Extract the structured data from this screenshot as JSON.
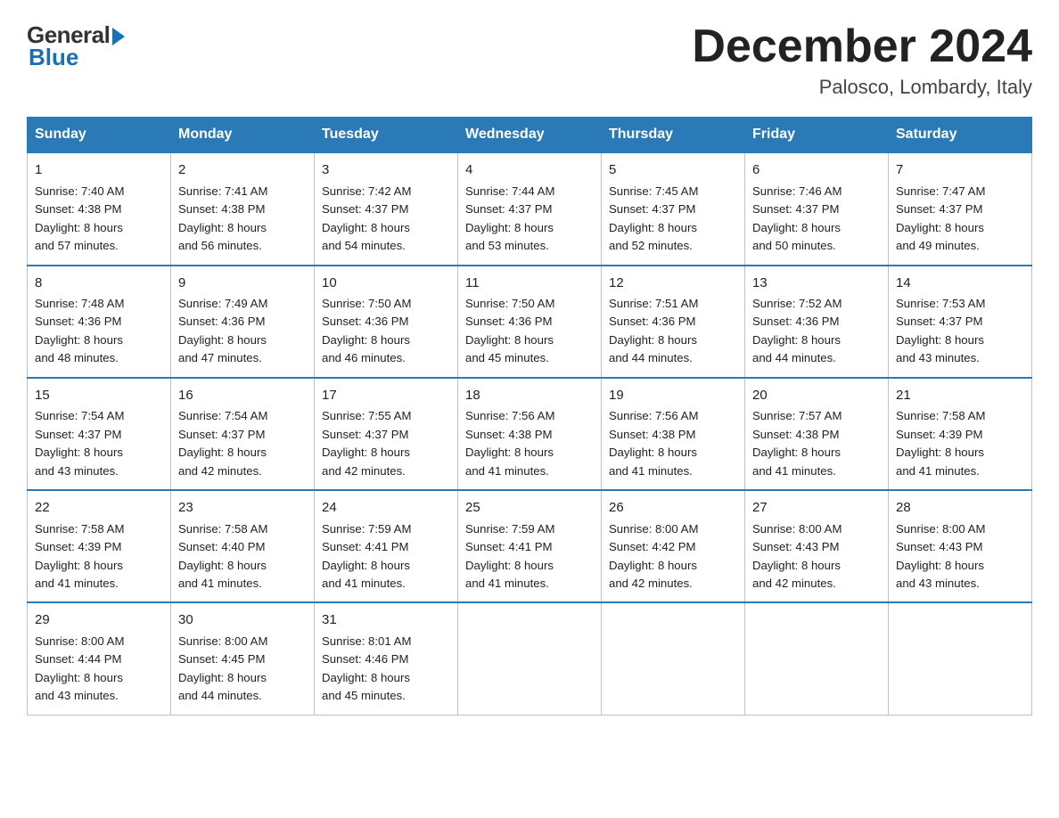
{
  "logo": {
    "general": "General",
    "blue": "Blue"
  },
  "header": {
    "month": "December 2024",
    "location": "Palosco, Lombardy, Italy"
  },
  "days_of_week": [
    "Sunday",
    "Monday",
    "Tuesday",
    "Wednesday",
    "Thursday",
    "Friday",
    "Saturday"
  ],
  "weeks": [
    [
      {
        "day": "1",
        "info": "Sunrise: 7:40 AM\nSunset: 4:38 PM\nDaylight: 8 hours\nand 57 minutes."
      },
      {
        "day": "2",
        "info": "Sunrise: 7:41 AM\nSunset: 4:38 PM\nDaylight: 8 hours\nand 56 minutes."
      },
      {
        "day": "3",
        "info": "Sunrise: 7:42 AM\nSunset: 4:37 PM\nDaylight: 8 hours\nand 54 minutes."
      },
      {
        "day": "4",
        "info": "Sunrise: 7:44 AM\nSunset: 4:37 PM\nDaylight: 8 hours\nand 53 minutes."
      },
      {
        "day": "5",
        "info": "Sunrise: 7:45 AM\nSunset: 4:37 PM\nDaylight: 8 hours\nand 52 minutes."
      },
      {
        "day": "6",
        "info": "Sunrise: 7:46 AM\nSunset: 4:37 PM\nDaylight: 8 hours\nand 50 minutes."
      },
      {
        "day": "7",
        "info": "Sunrise: 7:47 AM\nSunset: 4:37 PM\nDaylight: 8 hours\nand 49 minutes."
      }
    ],
    [
      {
        "day": "8",
        "info": "Sunrise: 7:48 AM\nSunset: 4:36 PM\nDaylight: 8 hours\nand 48 minutes."
      },
      {
        "day": "9",
        "info": "Sunrise: 7:49 AM\nSunset: 4:36 PM\nDaylight: 8 hours\nand 47 minutes."
      },
      {
        "day": "10",
        "info": "Sunrise: 7:50 AM\nSunset: 4:36 PM\nDaylight: 8 hours\nand 46 minutes."
      },
      {
        "day": "11",
        "info": "Sunrise: 7:50 AM\nSunset: 4:36 PM\nDaylight: 8 hours\nand 45 minutes."
      },
      {
        "day": "12",
        "info": "Sunrise: 7:51 AM\nSunset: 4:36 PM\nDaylight: 8 hours\nand 44 minutes."
      },
      {
        "day": "13",
        "info": "Sunrise: 7:52 AM\nSunset: 4:36 PM\nDaylight: 8 hours\nand 44 minutes."
      },
      {
        "day": "14",
        "info": "Sunrise: 7:53 AM\nSunset: 4:37 PM\nDaylight: 8 hours\nand 43 minutes."
      }
    ],
    [
      {
        "day": "15",
        "info": "Sunrise: 7:54 AM\nSunset: 4:37 PM\nDaylight: 8 hours\nand 43 minutes."
      },
      {
        "day": "16",
        "info": "Sunrise: 7:54 AM\nSunset: 4:37 PM\nDaylight: 8 hours\nand 42 minutes."
      },
      {
        "day": "17",
        "info": "Sunrise: 7:55 AM\nSunset: 4:37 PM\nDaylight: 8 hours\nand 42 minutes."
      },
      {
        "day": "18",
        "info": "Sunrise: 7:56 AM\nSunset: 4:38 PM\nDaylight: 8 hours\nand 41 minutes."
      },
      {
        "day": "19",
        "info": "Sunrise: 7:56 AM\nSunset: 4:38 PM\nDaylight: 8 hours\nand 41 minutes."
      },
      {
        "day": "20",
        "info": "Sunrise: 7:57 AM\nSunset: 4:38 PM\nDaylight: 8 hours\nand 41 minutes."
      },
      {
        "day": "21",
        "info": "Sunrise: 7:58 AM\nSunset: 4:39 PM\nDaylight: 8 hours\nand 41 minutes."
      }
    ],
    [
      {
        "day": "22",
        "info": "Sunrise: 7:58 AM\nSunset: 4:39 PM\nDaylight: 8 hours\nand 41 minutes."
      },
      {
        "day": "23",
        "info": "Sunrise: 7:58 AM\nSunset: 4:40 PM\nDaylight: 8 hours\nand 41 minutes."
      },
      {
        "day": "24",
        "info": "Sunrise: 7:59 AM\nSunset: 4:41 PM\nDaylight: 8 hours\nand 41 minutes."
      },
      {
        "day": "25",
        "info": "Sunrise: 7:59 AM\nSunset: 4:41 PM\nDaylight: 8 hours\nand 41 minutes."
      },
      {
        "day": "26",
        "info": "Sunrise: 8:00 AM\nSunset: 4:42 PM\nDaylight: 8 hours\nand 42 minutes."
      },
      {
        "day": "27",
        "info": "Sunrise: 8:00 AM\nSunset: 4:43 PM\nDaylight: 8 hours\nand 42 minutes."
      },
      {
        "day": "28",
        "info": "Sunrise: 8:00 AM\nSunset: 4:43 PM\nDaylight: 8 hours\nand 43 minutes."
      }
    ],
    [
      {
        "day": "29",
        "info": "Sunrise: 8:00 AM\nSunset: 4:44 PM\nDaylight: 8 hours\nand 43 minutes."
      },
      {
        "day": "30",
        "info": "Sunrise: 8:00 AM\nSunset: 4:45 PM\nDaylight: 8 hours\nand 44 minutes."
      },
      {
        "day": "31",
        "info": "Sunrise: 8:01 AM\nSunset: 4:46 PM\nDaylight: 8 hours\nand 45 minutes."
      },
      {
        "day": "",
        "info": ""
      },
      {
        "day": "",
        "info": ""
      },
      {
        "day": "",
        "info": ""
      },
      {
        "day": "",
        "info": ""
      }
    ]
  ]
}
